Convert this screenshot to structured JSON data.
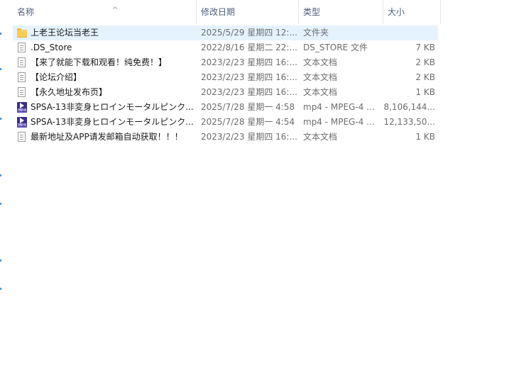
{
  "columns": {
    "name": "名称",
    "date": "修改日期",
    "type": "类型",
    "size": "大小",
    "sort_arrow": "^"
  },
  "files": [
    {
      "icon": "folder-icon",
      "name": "上老王论坛当老王",
      "date": "2025/5/29 星期四 12:...",
      "type": "文件夹",
      "size": "",
      "selected": true
    },
    {
      "icon": "document-icon",
      "name": ".DS_Store",
      "date": "2022/8/16 星期二 22:...",
      "type": "DS_STORE 文件",
      "size": "7 KB",
      "selected": false
    },
    {
      "icon": "document-icon",
      "name": "【来了就能下载和观看！纯免费！】",
      "date": "2023/2/23 星期四 16:...",
      "type": "文本文档",
      "size": "2 KB",
      "selected": false
    },
    {
      "icon": "document-icon",
      "name": "【论坛介绍】",
      "date": "2023/2/23 星期四 16:...",
      "type": "文本文档",
      "size": "2 KB",
      "selected": false
    },
    {
      "icon": "document-icon",
      "name": "【永久地址发布页】",
      "date": "2023/2/23 星期四 16:...",
      "type": "文本文档",
      "size": "1 KB",
      "selected": false
    },
    {
      "icon": "mp4-icon",
      "name": "SPSA-13非変身ヒロインモータルピンク...",
      "date": "2025/7/28 星期一 4:58",
      "type": "mp4 - MPEG-4 ...",
      "size": "8,106,144...",
      "selected": false
    },
    {
      "icon": "mp4-icon",
      "name": "SPSA-13非変身ヒロインモータルピンク...",
      "date": "2025/7/28 星期一 4:54",
      "type": "mp4 - MPEG-4 ...",
      "size": "12,133,50...",
      "selected": false
    },
    {
      "icon": "document-icon",
      "name": "最新地址及APP请发邮箱自动获取！！！",
      "date": "2023/2/23 星期四 16:...",
      "type": "文本文档",
      "size": "1 KB",
      "selected": false
    }
  ],
  "mp4_icon_label": "MP4",
  "colors": {
    "selection": "#e5f3ff",
    "header_text": "#4c607a",
    "folder": "#f8cd55",
    "mp4_icon": "#3c2d8f"
  }
}
